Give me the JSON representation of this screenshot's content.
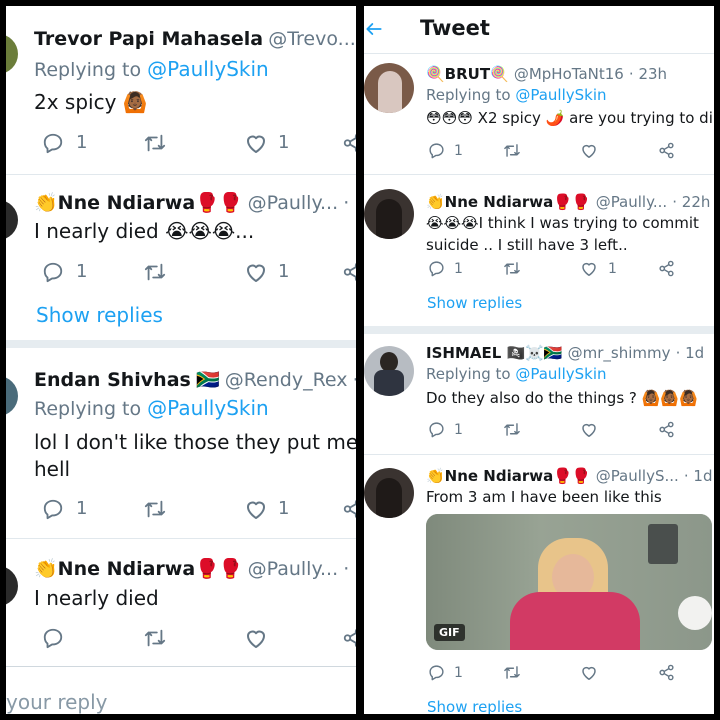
{
  "left": {
    "tweets": [
      {
        "name": "Trevor Papi Mahasela",
        "handle": "@Trevo...",
        "dot": "·",
        "replying": "Replying to ",
        "replying_to": "@PaullySkin",
        "body": "2x spicy 🙆🏾",
        "reply_count": "1",
        "like_count": "1"
      },
      {
        "name": "Nne Ndiarwa",
        "name_prefix_emoji": "👏",
        "name_suffix_emoji": "🥊🥊",
        "handle": "@Paully...",
        "dot": "·",
        "body": "I nearly died 😭😭😭...",
        "reply_count": "1",
        "like_count": "1",
        "show_replies": "Show replies"
      },
      {
        "name": "Endan Shivhas",
        "flag": "🇿🇦",
        "handle": "@Rendy_Rex",
        "dot": "·",
        "replying": "Replying to ",
        "replying_to": "@PaullySkin",
        "body_line1": "lol I don't like those they put me th",
        "body_line2": "hell",
        "reply_count": "1",
        "like_count": "1"
      },
      {
        "name": "Nne Ndiarwa",
        "name_prefix_emoji": "👏",
        "name_suffix_emoji": "🥊🥊",
        "handle": "@Paully...",
        "dot": "·",
        "body": "I nearly died"
      }
    ],
    "compose_placeholder": "your reply"
  },
  "right": {
    "header": {
      "back_icon": "arrow-left-icon",
      "title": "Tweet"
    },
    "tweets": [
      {
        "name": "🍭BRUT🍭",
        "handle": "@MpHoTaNt16",
        "time": "· 23h",
        "replying": "Replying to ",
        "replying_to": "@PaullySkin",
        "body": "😳😳😳 X2 spicy 🌶️ are you trying to di",
        "reply_count": "1"
      },
      {
        "name": "👏Nne Ndiarwa🥊🥊",
        "handle": "@Paully...",
        "time": "· 22h",
        "body_line1": "😭😭😭I think I was trying  to commit",
        "body_line2": "suicide .. I still have 3 left..",
        "reply_count": "1",
        "like_count": "1",
        "show_replies": "Show replies"
      },
      {
        "name": "ISHMAEL 🏴‍☠️☠️🇿🇦",
        "handle": "@mr_shimmy",
        "time": "· 1d",
        "replying": "Replying to ",
        "replying_to": "@PaullySkin",
        "body": "Do they also do the things ? 🙆🏾🙆🏾🙆🏾",
        "reply_count": "1"
      },
      {
        "name": "👏Nne Ndiarwa🥊🥊",
        "handle": "@PaullyS...",
        "time": "· 1d",
        "body": "From 3 am I have been like this",
        "gif_badge": "GIF",
        "reply_count": "1",
        "show_replies": "Show replies"
      }
    ]
  },
  "colors": {
    "accent": "#1da1f2",
    "text": "#14171a",
    "muted": "#657786",
    "divider": "#e6ecf0",
    "border": "#000000"
  }
}
